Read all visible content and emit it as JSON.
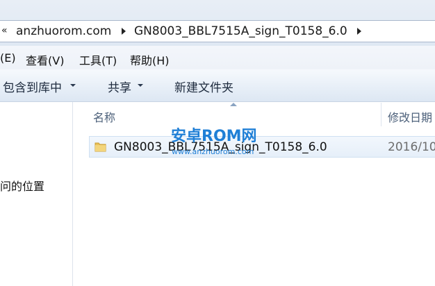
{
  "address_bar": {
    "overflow_glyph": "«",
    "crumbs": [
      "anzhuorom.com",
      "GN8003_BBL7515A_sign_T0158_6.0"
    ]
  },
  "menu": {
    "items": [
      "(E)",
      "查看(V)",
      "工具(T)",
      "帮助(H)"
    ]
  },
  "toolbar": {
    "include_library_label": "包含到库中",
    "share_label": "共享",
    "new_folder_label": "新建文件夹"
  },
  "nav_pane": {
    "visible_text": "问的位置"
  },
  "file_list": {
    "columns": {
      "name": "名称",
      "modified": "修改日期"
    },
    "rows": [
      {
        "name": "GN8003_BBL7515A_sign_T0158_6.0",
        "modified": "2016/10",
        "icon": "folder-icon"
      }
    ]
  },
  "watermark": {
    "main": "安卓ROM网",
    "url": "www.anzhuorom.com",
    "color": "#1f7fd6"
  },
  "colors": {
    "toolbar_text": "#1d2a3d",
    "column_header_text": "#4c607a",
    "selected_row_border": "#cfe0f2",
    "folder_yellow": "#e8c15a"
  }
}
